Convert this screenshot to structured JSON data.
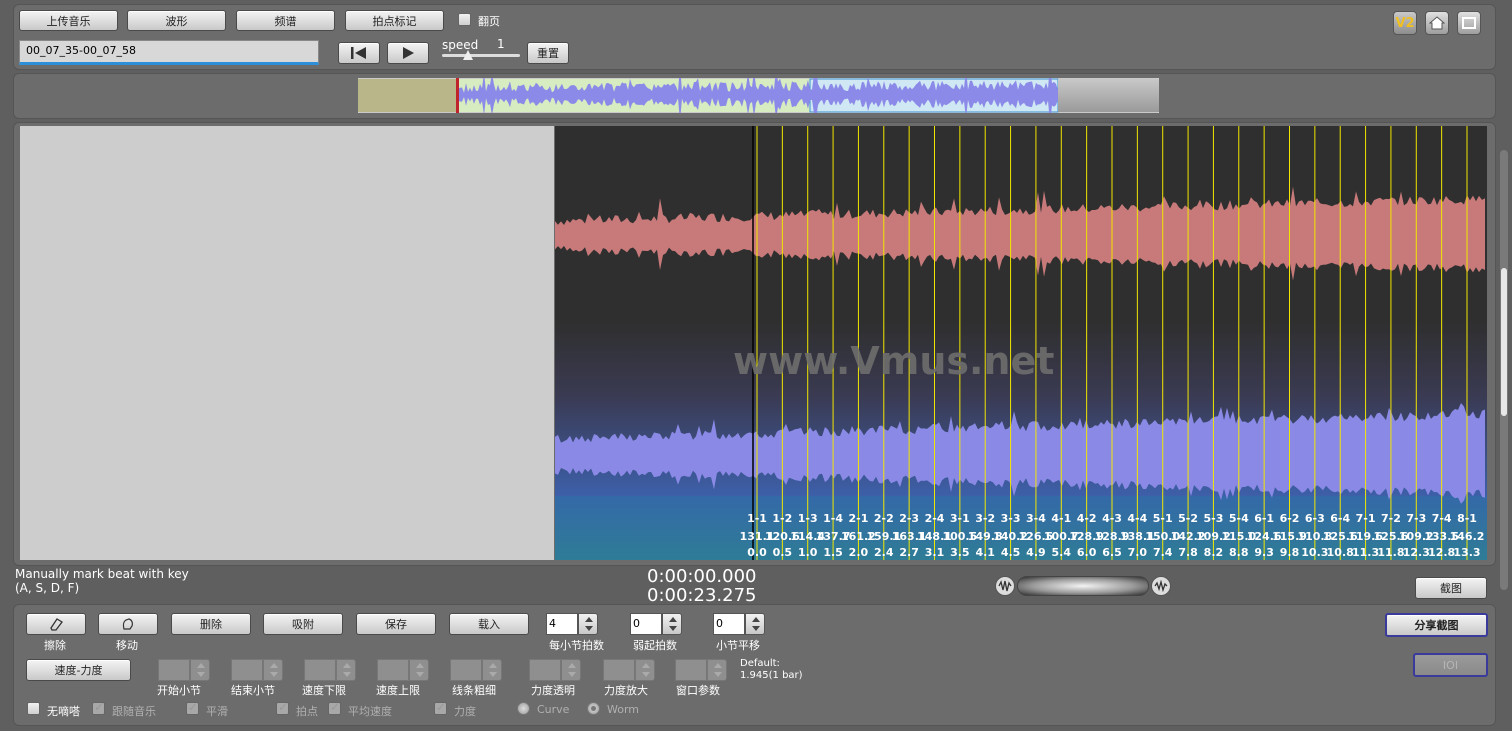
{
  "toolbar": {
    "upload_music": "上传音乐",
    "waveform": "波形",
    "spectrum": "频谱",
    "beat_mark": "拍点标记",
    "flip_page": "翻页",
    "filename_value": "00_07_35-00_07_58",
    "speed_label": "speed",
    "speed_value": "1",
    "reset": "重置",
    "badge_v2": "V2"
  },
  "viewer": {
    "watermark": "www.Vmus.net",
    "beats_row1": [
      "1-1",
      "1-2",
      "1-3",
      "1-4",
      "2-1",
      "2-2",
      "2-3",
      "2-4",
      "3-1",
      "3-2",
      "3-3",
      "3-4",
      "4-1",
      "4-2",
      "4-3",
      "4-4",
      "5-1",
      "5-2",
      "5-3",
      "5-4",
      "6-1",
      "6-2",
      "6-3",
      "6-4",
      "7-1",
      "7-2",
      "7-3",
      "7-4",
      "8-1"
    ],
    "beats_row2": [
      "131.1",
      "120.6",
      "114.4",
      "137.7",
      "161.2",
      "159.1",
      "163.1",
      "148.1",
      "100.5",
      "149.8",
      "140.2",
      "126.5",
      "100.7",
      "128.9",
      "128.9",
      "138.1",
      "150.0",
      "142.2",
      "109.2",
      "115.0",
      "124.6",
      "115.9",
      "110.8",
      "125.6",
      "119.6",
      "125.6",
      "109.2",
      "133.5",
      "146.2"
    ],
    "beats_row3": [
      "0.0",
      "0.5",
      "1.0",
      "1.5",
      "2.0",
      "2.4",
      "2.7",
      "3.1",
      "3.5",
      "4.1",
      "4.5",
      "4.9",
      "5.4",
      "6.0",
      "6.5",
      "7.0",
      "7.4",
      "7.8",
      "8.2",
      "8.8",
      "9.3",
      "9.8",
      "10.3",
      "10.8",
      "11.3",
      "11.8",
      "12.3",
      "12.8",
      "13.3"
    ]
  },
  "status": {
    "hint_line1": "Manually mark beat with key",
    "hint_line2": "(A, S, D, F)",
    "time_current": "0:00:00.000",
    "time_total": "0:00:23.275",
    "screenshot": "截图"
  },
  "controls": {
    "erase": "擦除",
    "move": "移动",
    "delete": "删除",
    "snap": "吸附",
    "save": "保存",
    "load": "载入",
    "beats_per_bar_value": "4",
    "beats_per_bar": "每小节拍数",
    "pickup_value": "0",
    "pickup": "弱起拍数",
    "bar_shift_value": "0",
    "bar_shift": "小节平移",
    "share_screenshot": "分享截图",
    "tempo_dynamics": "速度-力度",
    "start_bar": "开始小节",
    "end_bar": "结束小节",
    "tempo_min": "速度下限",
    "tempo_max": "速度上限",
    "line_width": "线条粗细",
    "dyn_opacity": "力度透明",
    "dyn_zoom": "力度放大",
    "window_param": "窗口参数",
    "default_label": "Default:",
    "default_value": "1.945(1 bar)",
    "ioi": "IOI",
    "no_ticks": "无嘀嗒",
    "follow_music": "跟随音乐",
    "smooth": "平滑",
    "beat_point": "拍点",
    "avg_tempo": "平均速度",
    "dynamics": "力度",
    "curve": "Curve",
    "worm": "Worm"
  }
}
